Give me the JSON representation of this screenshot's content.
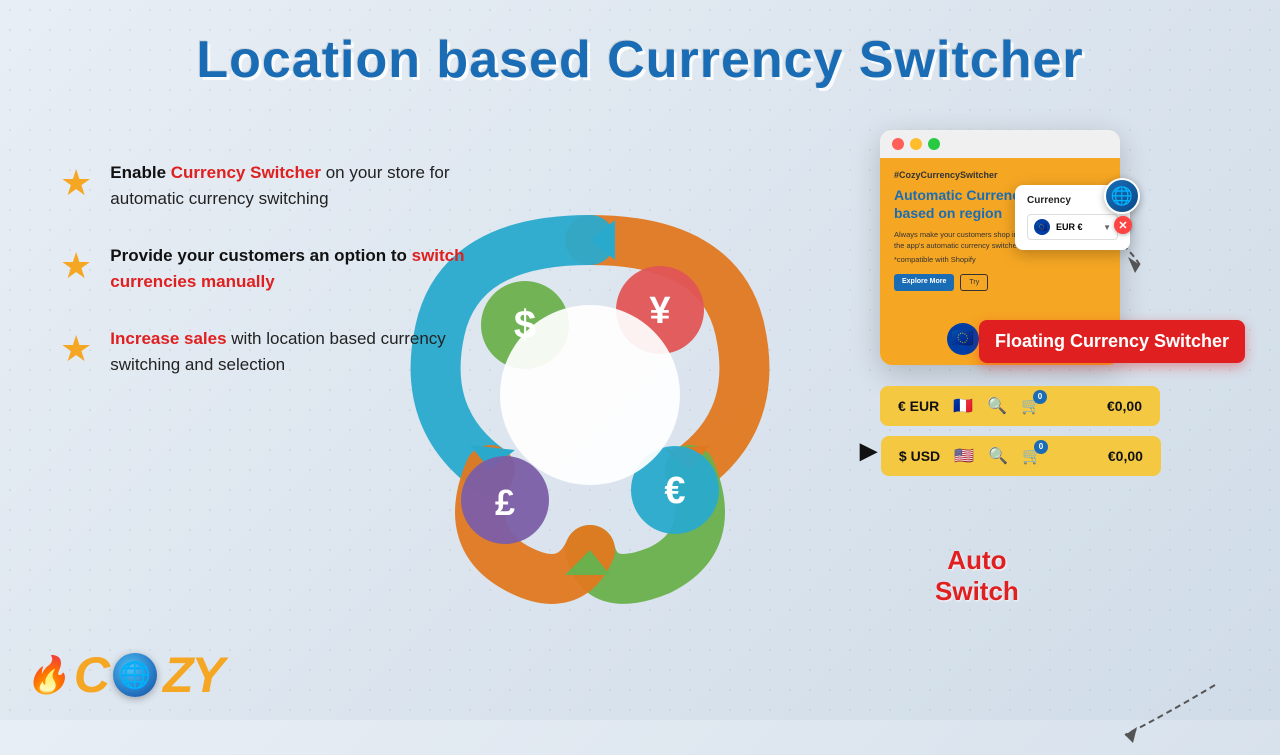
{
  "title": "Location based Currency Switcher",
  "features": [
    {
      "id": "feature-1",
      "text_before": "Enable ",
      "highlight": "Currency Switcher",
      "text_after": " on your store for automatic currency switching"
    },
    {
      "id": "feature-2",
      "text_before": "Provide your customers an option to ",
      "highlight": "switch currencies manually",
      "text_after": ""
    },
    {
      "id": "feature-3",
      "text_before": "",
      "highlight": "Increase sales",
      "text_after": " with location based currency switching and selection"
    }
  ],
  "auto_switch_label": "Auto\nSwitch",
  "browser": {
    "hashtag": "#CozyCurrencySwitcher",
    "heading": "Automatic Currency Switching based on region",
    "body": "Always make your customers shop in the right currency using the app's automatic currency switcher.",
    "compat": "*compatible with Shopify",
    "btn_explore": "Explore More",
    "btn_secondary": "Try",
    "currency_popup_title": "Currency",
    "currency_value": "EUR €"
  },
  "floating_label": "Floating\nCurrency\nSwitcher",
  "eur_bar": {
    "currency": "€ EUR",
    "badge": "0",
    "price": "€0,00"
  },
  "usd_bar": {
    "currency": "$ USD",
    "badge": "0",
    "price": "€0,00"
  },
  "logo": "C ZY"
}
